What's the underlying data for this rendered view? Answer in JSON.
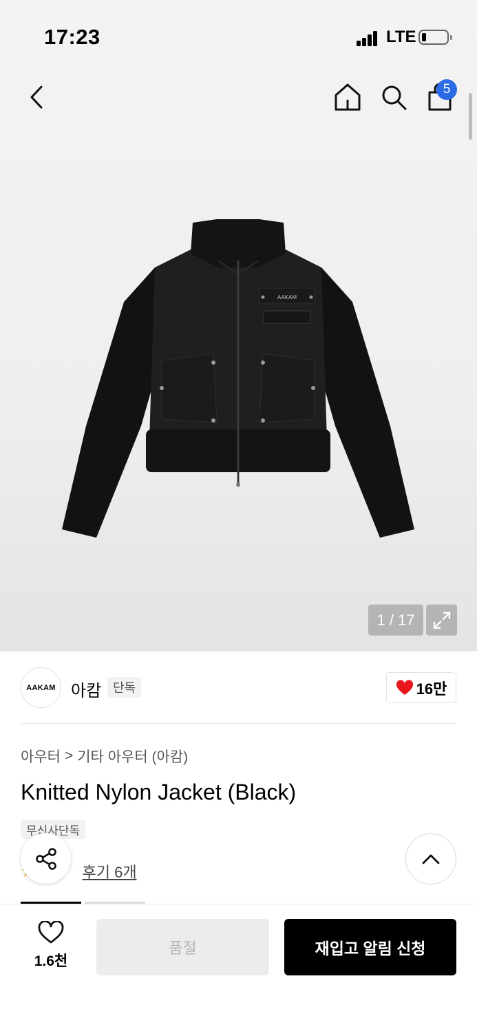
{
  "status_bar": {
    "time": "17:23",
    "network": "LTE"
  },
  "header": {
    "cart_count": "5"
  },
  "gallery": {
    "page_indicator": "1 / 17",
    "product_logo_text": "AAKAM"
  },
  "brand": {
    "logo_text": "AAKAM",
    "name": "아캄",
    "exclusive_label": "단독",
    "likes": "16만"
  },
  "breadcrumb": {
    "category": "아우터",
    "separator": ">",
    "subcategory": "기타 아우터 (아캄)"
  },
  "product": {
    "title": "Knitted Nylon Jacket (Black)",
    "tag": "무신사단독",
    "review_label": "후기 6개"
  },
  "bottom_bar": {
    "wish_count": "1.6천",
    "soldout_label": "품절",
    "restock_label": "재입고 알림 신청"
  },
  "colors": {
    "accent_badge": "#2c6ae6",
    "heart": "#e8141e",
    "primary_button": "#000000"
  }
}
